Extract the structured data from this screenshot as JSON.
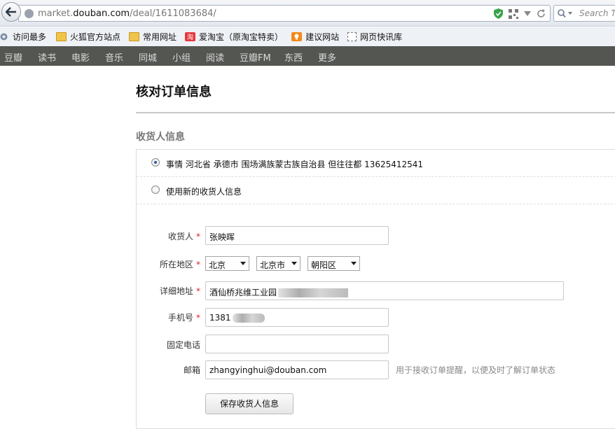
{
  "browser": {
    "url_prefix": "market.",
    "url_domain": "douban.com",
    "url_path": "/deal/1611083684/",
    "search_placeholder": "Search Ti"
  },
  "bookmarks": [
    "访问最多",
    "火狐官方站点",
    "常用网址",
    "爱淘宝（原淘宝特卖）",
    "建议网站",
    "网页快讯库"
  ],
  "nav": [
    "豆瓣",
    "读书",
    "电影",
    "音乐",
    "同城",
    "小组",
    "阅读",
    "豆瓣FM",
    "东西",
    "更多"
  ],
  "page": {
    "title": "核对订单信息",
    "section_title": "收货人信息"
  },
  "addresses": {
    "existing": "事情 河北省 承德市 围场满族蒙古族自治县 但往往都 13625412541",
    "new": "使用新的收货人信息"
  },
  "form": {
    "name_label": "收货人",
    "name_value": "张映晖",
    "region_label": "所在地区",
    "province": "北京",
    "city": "北京市",
    "district": "朝阳区",
    "address_label": "详细地址",
    "address_value": "酒仙桥兆维工业园",
    "mobile_label": "手机号",
    "mobile_value": "1381",
    "phone_label": "固定电话",
    "phone_value": "",
    "email_label": "邮箱",
    "email_value": "zhangyinghui@douban.com",
    "email_hint": "用于接收订单提醒，以便及时了解订单状态",
    "required_mark": "*",
    "save_label": "保存收货人信息"
  }
}
